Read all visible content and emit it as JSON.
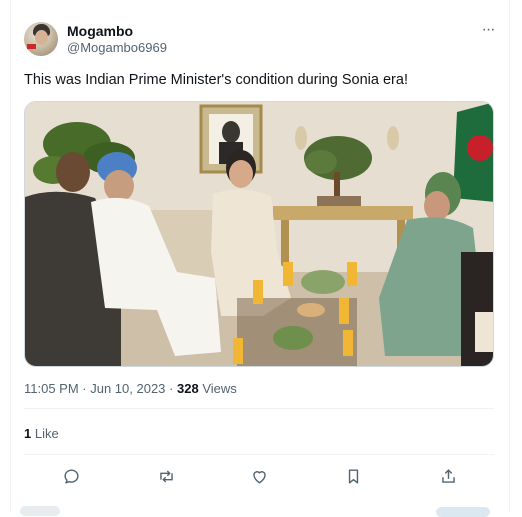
{
  "author": {
    "display_name": "Mogambo",
    "handle": "@Mogambo6969"
  },
  "tweet": {
    "text": "This was Indian Prime Minister's condition during Sonia era!"
  },
  "meta": {
    "time_date": "11:05 PM · Jun 10, 2023 ·",
    "views_count": "328",
    "views_label": "Views"
  },
  "engagement": {
    "likes_count": "1",
    "likes_label": "Like"
  },
  "more_glyph": "···",
  "colors": {
    "secondary_text": "#536471",
    "divider": "#eff3f4",
    "primary_text": "#0f1419"
  },
  "icons": {
    "actions": [
      "reply-icon",
      "retweet-icon",
      "like-icon",
      "bookmark-icon",
      "share-icon"
    ]
  }
}
